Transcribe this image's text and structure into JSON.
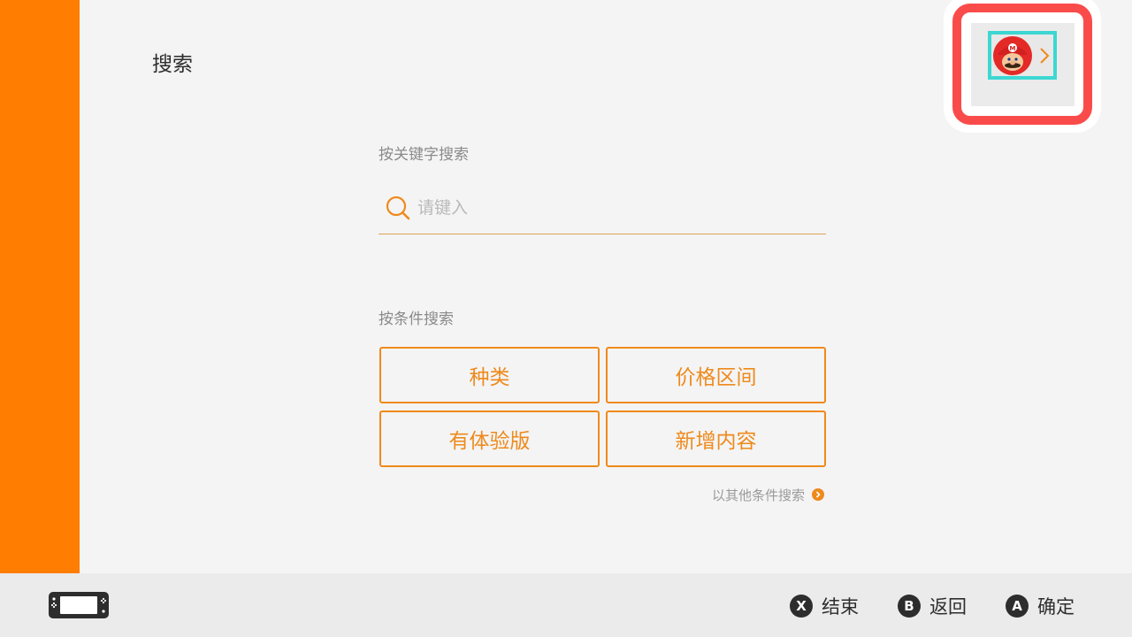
{
  "header": {
    "title": "搜索"
  },
  "profile": {
    "avatar_icon": "mario-avatar-icon",
    "chevron_icon": "chevron-right-icon",
    "accent_color": "#3cd7d2",
    "focus_color": "#fa4b4b"
  },
  "keyword_search": {
    "label": "按关键字搜索",
    "placeholder": "请键入",
    "value": "",
    "icon": "search-icon"
  },
  "condition_search": {
    "label": "按条件搜索",
    "buttons": [
      {
        "label": "种类"
      },
      {
        "label": "价格区间"
      },
      {
        "label": "有体验版"
      },
      {
        "label": "新增内容"
      }
    ],
    "other_link": "以其他条件搜索"
  },
  "footer": {
    "console_icon": "handheld-console-icon",
    "actions": [
      {
        "key": "X",
        "label": "结束"
      },
      {
        "key": "B",
        "label": "返回"
      },
      {
        "key": "A",
        "label": "确定"
      }
    ]
  },
  "colors": {
    "sidebar": "#ff7d00",
    "accent_orange": "#ee8a1c",
    "background": "#f4f4f4"
  }
}
